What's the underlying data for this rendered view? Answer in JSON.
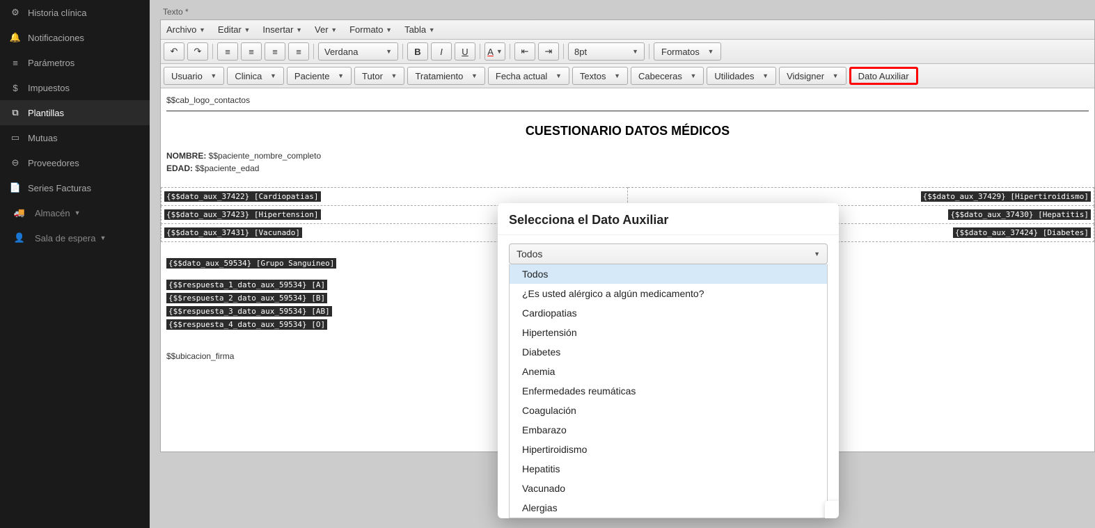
{
  "sidebar": {
    "items": [
      {
        "label": "Historia clínica",
        "icon": "gear"
      },
      {
        "label": "Notificaciones",
        "icon": "bell"
      },
      {
        "label": "Parámetros",
        "icon": "sliders"
      },
      {
        "label": "Impuestos",
        "icon": "coin"
      },
      {
        "label": "Plantillas",
        "icon": "copy",
        "active": true
      },
      {
        "label": "Mutuas",
        "icon": "card"
      },
      {
        "label": "Proveedores",
        "icon": "minus-circle"
      },
      {
        "label": "Series Facturas",
        "icon": "file"
      }
    ],
    "subitems": [
      {
        "label": "Almacén",
        "icon": "truck",
        "dropdown": true
      },
      {
        "label": "Sala de espera",
        "icon": "person",
        "dropdown": true
      }
    ]
  },
  "editor": {
    "field_label": "Texto *",
    "menus": [
      "Archivo",
      "Editar",
      "Insertar",
      "Ver",
      "Formato",
      "Tabla"
    ],
    "font_family": "Verdana",
    "font_size": "8pt",
    "formats_label": "Formatos",
    "row2_buttons": [
      "Usuario",
      "Clinica",
      "Paciente",
      "Tutor",
      "Tratamiento",
      "Fecha actual",
      "Textos",
      "Cabeceras",
      "Utilidades",
      "Vidsigner"
    ],
    "highlight_button": "Dato Auxiliar"
  },
  "doc": {
    "header_ph": "$$cab_logo_contactos",
    "title": "CUESTIONARIO DATOS MÉDICOS",
    "name_label": "NOMBRE:",
    "name_value": "$$paciente_nombre_completo",
    "age_label": "EDAD:",
    "age_value": "$$paciente_edad",
    "left_chips": [
      "{$$dato_aux_37422} [Cardiopatias]",
      "{$$dato_aux_37423} [Hipertension]",
      "{$$dato_aux_37431} [Vacunado]"
    ],
    "right_chips": [
      "{$$dato_aux_37429} [Hipertiroidismo]",
      "{$$dato_aux_37430} [Hepatitis]",
      "{$$dato_aux_37424} [Diabetes]"
    ],
    "group_line": "{$$dato_aux_59534} [Grupo Sanguineo]",
    "responses": [
      "{$$respuesta_1_dato_aux_59534} [A]",
      "{$$respuesta_2_dato_aux_59534} [B]",
      "{$$respuesta_3_dato_aux_59534} [AB]",
      "{$$respuesta_4_dato_aux_59534} [O]"
    ],
    "signature_ph": "$$ubicacion_firma"
  },
  "modal": {
    "title": "Selecciona el Dato Auxiliar",
    "selected": "Todos",
    "options": [
      "Todos",
      "¿Es usted alérgico a algún medicamento?",
      "Cardiopatias",
      "Hipertensión",
      "Diabetes",
      "Anemia",
      "Enfermedades reumáticas",
      "Coagulación",
      "Embarazo",
      "Hipertiroidismo",
      "Hepatitis",
      "Vacunado",
      "Alergias"
    ]
  }
}
